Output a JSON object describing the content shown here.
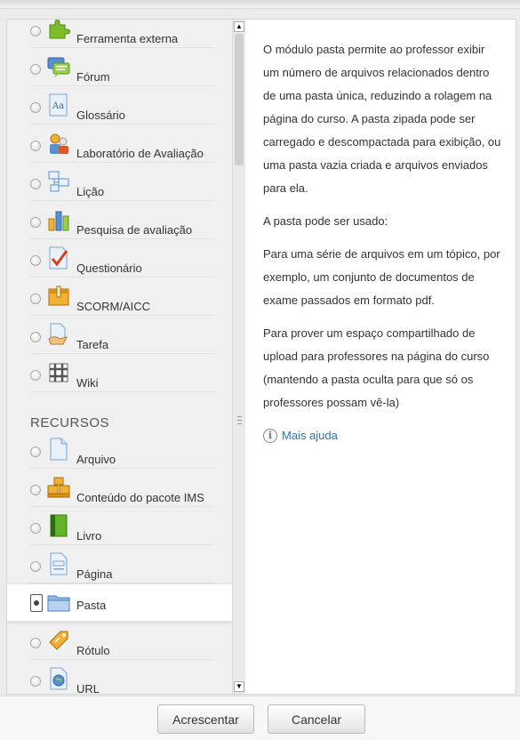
{
  "activities": [
    {
      "label": "Ferramenta externa",
      "icon": "puzzle-icon"
    },
    {
      "label": "Fórum",
      "icon": "forum-icon"
    },
    {
      "label": "Glossário",
      "icon": "glossary-icon"
    },
    {
      "label": "Laboratório de Avaliação",
      "icon": "workshop-icon"
    },
    {
      "label": "Lição",
      "icon": "lesson-icon"
    },
    {
      "label": "Pesquisa de avaliação",
      "icon": "survey-icon"
    },
    {
      "label": "Questionário",
      "icon": "quiz-icon"
    },
    {
      "label": "SCORM/AICC",
      "icon": "scorm-icon"
    },
    {
      "label": "Tarefa",
      "icon": "assignment-icon"
    },
    {
      "label": "Wiki",
      "icon": "wiki-icon"
    }
  ],
  "resources_heading": "RECURSOS",
  "resources": [
    {
      "label": "Arquivo",
      "icon": "file-icon"
    },
    {
      "label": "Conteúdo do pacote IMS",
      "icon": "ims-package-icon"
    },
    {
      "label": "Livro",
      "icon": "book-icon"
    },
    {
      "label": "Página",
      "icon": "page-icon"
    },
    {
      "label": "Pasta",
      "icon": "folder-icon",
      "selected": true
    },
    {
      "label": "Rótulo",
      "icon": "label-icon"
    },
    {
      "label": "URL",
      "icon": "url-icon"
    }
  ],
  "help": {
    "paragraphs": [
      "O módulo pasta permite ao professor exibir um número de arquivos relacionados dentro de uma pasta única, reduzindo a rolagem na página do curso. A pasta zipada pode ser carregado e descompactada para exibição, ou uma pasta vazia criada e arquivos enviados para ela.",
      "A pasta pode ser usado:",
      "Para uma série de arquivos em um tópico, por exemplo, um conjunto de documentos de exame passados em formato pdf.",
      "Para prover um espaço compartilhado de upload para professores na página do curso (mantendo a pasta oculta para que só os professores possam vê-la)"
    ],
    "more_help": "Mais ajuda"
  },
  "buttons": {
    "add": "Acrescentar",
    "cancel": "Cancelar"
  },
  "colors": {
    "link": "#2a73a8",
    "pane_bg": "#f0f0f0"
  }
}
